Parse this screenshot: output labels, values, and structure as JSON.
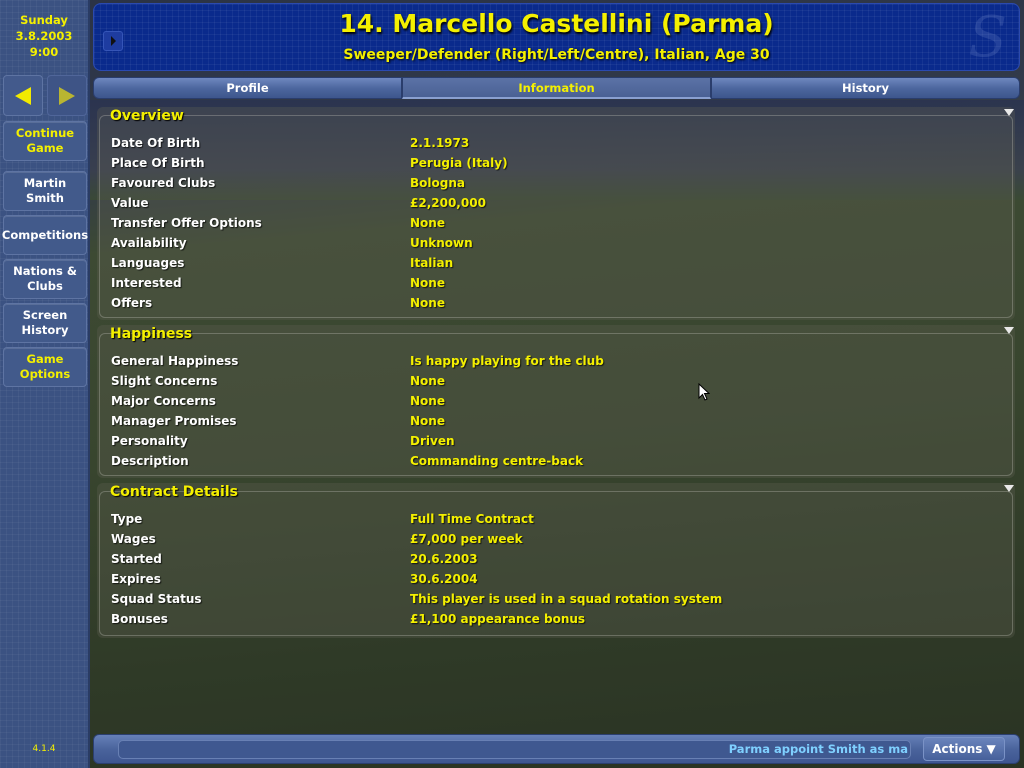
{
  "sidebar": {
    "date": {
      "day": "Sunday",
      "date": "3.8.2003",
      "time": "9:00"
    },
    "nav": {
      "back_icon": "arrow-left-icon",
      "forward_icon": "arrow-right-icon"
    },
    "buttons": [
      {
        "label": "Continue Game",
        "highlight": true
      },
      {
        "label": "Martin Smith",
        "highlight": false
      },
      {
        "label": "Competitions",
        "highlight": false
      },
      {
        "label": "Nations & Clubs",
        "highlight": false
      },
      {
        "label": "Screen History",
        "highlight": false
      },
      {
        "label": "Game Options",
        "highlight": true
      }
    ],
    "version": "4.1.4"
  },
  "header": {
    "title": "14. Marcello Castellini (Parma)",
    "subtitle": "Sweeper/Defender (Right/Left/Centre), Italian, Age 30",
    "logo": "S"
  },
  "tabs": [
    {
      "label": "Profile",
      "active": false
    },
    {
      "label": "Information",
      "active": true
    },
    {
      "label": "History",
      "active": false
    }
  ],
  "panels": {
    "overview": {
      "title": "Overview",
      "rows": [
        {
          "label": "Date Of Birth",
          "value": "2.1.1973"
        },
        {
          "label": "Place Of Birth",
          "value": "Perugia (Italy)"
        },
        {
          "label": "Favoured Clubs",
          "value": "Bologna"
        },
        {
          "label": "Value",
          "value": "£2,200,000"
        },
        {
          "label": "Transfer Offer Options",
          "value": "None"
        },
        {
          "label": "Availability",
          "value": "Unknown"
        },
        {
          "label": "Languages",
          "value": "Italian"
        },
        {
          "label": "Interested",
          "value": "None"
        },
        {
          "label": "Offers",
          "value": "None"
        }
      ]
    },
    "happiness": {
      "title": "Happiness",
      "rows": [
        {
          "label": "General Happiness",
          "value": "Is happy playing for the club"
        },
        {
          "label": "Slight Concerns",
          "value": "None"
        },
        {
          "label": "Major Concerns",
          "value": "None"
        },
        {
          "label": "Manager Promises",
          "value": "None"
        },
        {
          "label": "Personality",
          "value": "Driven"
        },
        {
          "label": "Description",
          "value": "Commanding centre-back"
        }
      ]
    },
    "contract": {
      "title": "Contract Details",
      "rows": [
        {
          "label": "Type",
          "value": "Full Time Contract"
        },
        {
          "label": "Wages",
          "value": "£7,000 per week"
        },
        {
          "label": "Started",
          "value": "20.6.2003"
        },
        {
          "label": "Expires",
          "value": "30.6.2004"
        },
        {
          "label": "Squad Status",
          "value": "This player is used in a squad rotation system"
        },
        {
          "label": "Bonuses",
          "value": "£1,100 appearance bonus"
        }
      ]
    }
  },
  "bottom_bar": {
    "news": "Parma appoint Smith as ma",
    "actions_label": "Actions ▼"
  },
  "colors": {
    "accent_yellow": "#f4f000",
    "header_blue": "#0a2a8c",
    "sidebar_blue": "#3b5282",
    "news_text": "#7fd0ff"
  }
}
